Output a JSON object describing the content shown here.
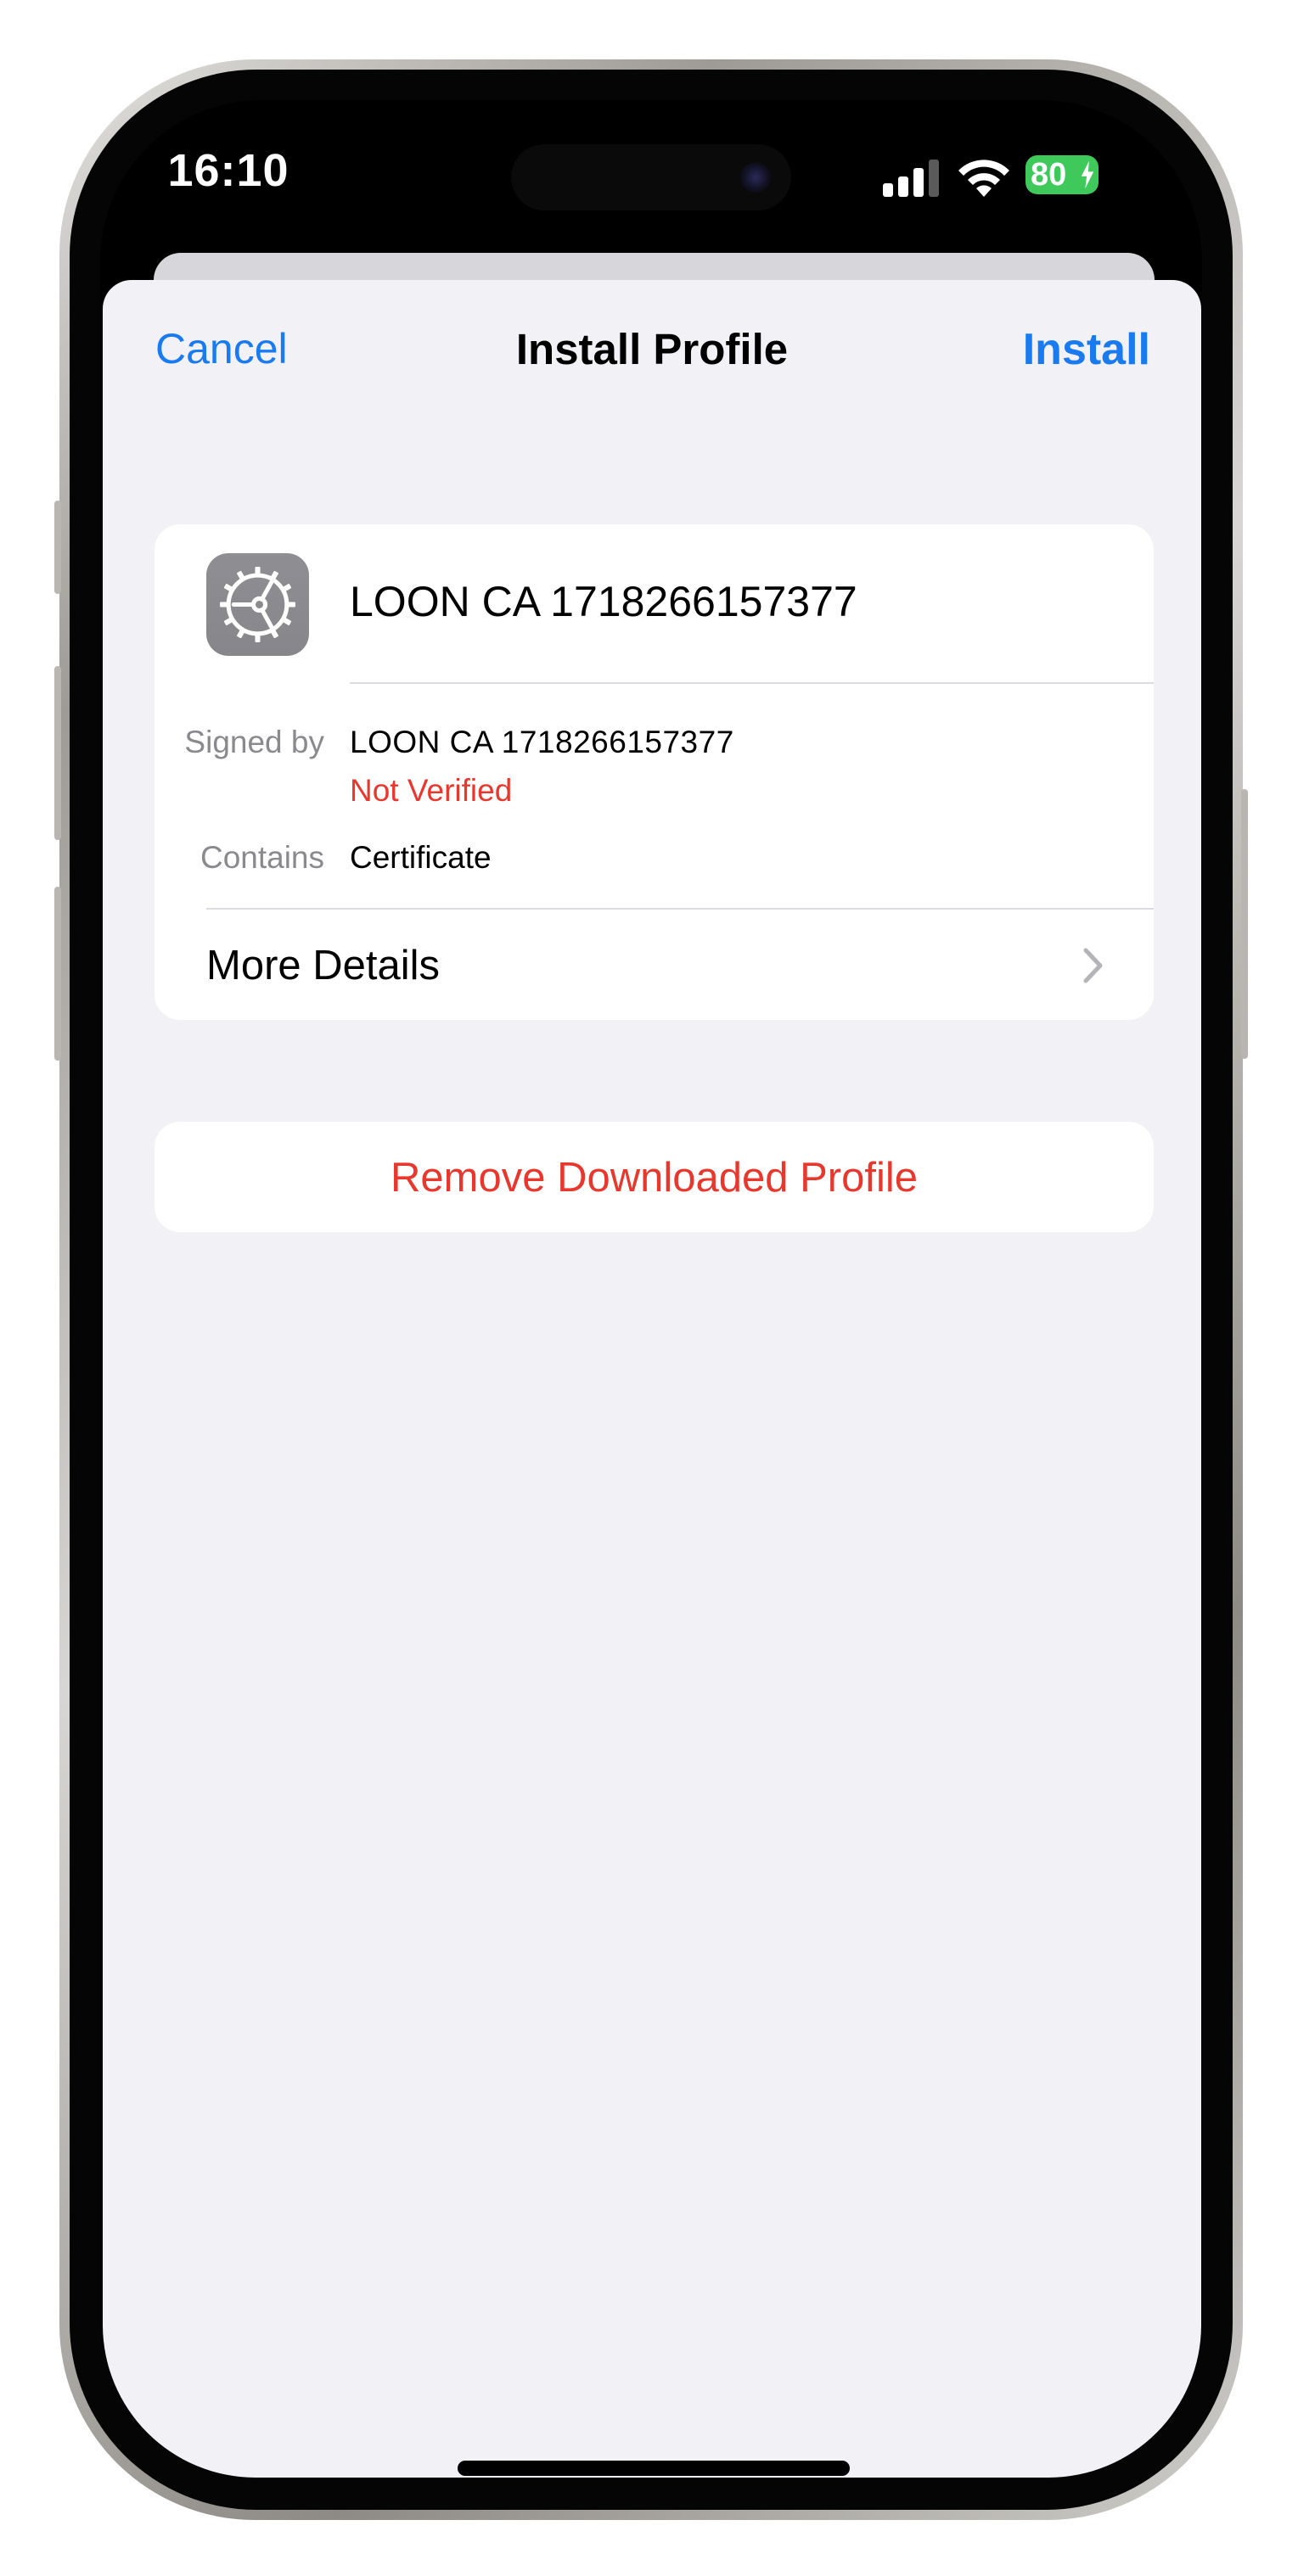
{
  "status_bar": {
    "time": "16:10",
    "battery_level": "80",
    "battery_color": "#3ec95a"
  },
  "nav": {
    "cancel_label": "Cancel",
    "title": "Install Profile",
    "install_label": "Install"
  },
  "profile": {
    "icon": "gear-icon",
    "name": "LOON CA 1718266157377",
    "signed_by_label": "Signed by",
    "signed_by_value": "LOON CA 1718266157377",
    "verification_status": "Not Verified",
    "contains_label": "Contains",
    "contains_value": "Certificate",
    "more_details_label": "More Details"
  },
  "remove_button_label": "Remove Downloaded Profile",
  "colors": {
    "accent": "#1a7bf0",
    "destructive": "#e8382e",
    "background": "#f1f1f6"
  }
}
